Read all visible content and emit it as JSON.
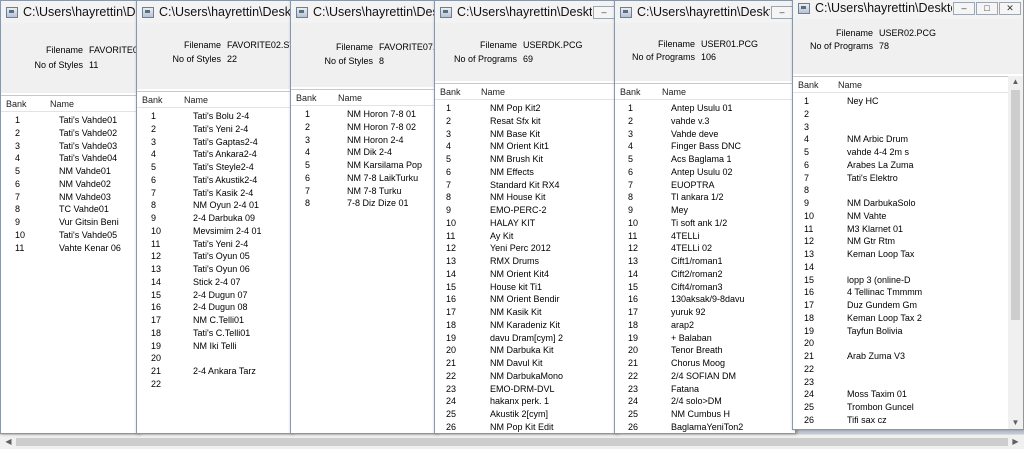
{
  "labels": {
    "filename": "Filename",
    "no_of_styles": "No of Styles",
    "no_of_programs": "No of Programs",
    "col_bank": "Bank",
    "col_name": "Name"
  },
  "windows": [
    {
      "title": "C:\\Users\\hayrettin\\Deskt",
      "filename": "FAVORITE0",
      "count_label_key": "no_of_styles",
      "count": "11",
      "rows": [
        [
          "1",
          "Tati's Vahde01"
        ],
        [
          "2",
          "Tati's Vahde02"
        ],
        [
          "3",
          "Tati's Vahde03"
        ],
        [
          "4",
          "Tati's Vahde04"
        ],
        [
          "5",
          "NM Vahde01"
        ],
        [
          "6",
          "NM Vahde02"
        ],
        [
          "7",
          "NM Vahde03"
        ],
        [
          "8",
          "TC Vahde01"
        ],
        [
          "9",
          "Vur Gitsin Beni"
        ],
        [
          "10",
          "Tati's Vahde05"
        ],
        [
          "11",
          "Vahte Kenar 06"
        ]
      ]
    },
    {
      "title": "C:\\Users\\hayrettin\\Deskt",
      "filename": "FAVORITE02.STY",
      "count_label_key": "no_of_styles",
      "count": "22",
      "rows": [
        [
          "1",
          "Tati's Bolu 2-4"
        ],
        [
          "2",
          "Tati's Yeni 2-4"
        ],
        [
          "3",
          "Tati's Gaptas2-4"
        ],
        [
          "4",
          "Tati's Ankara2-4"
        ],
        [
          "5",
          "Tati's Steyle2-4"
        ],
        [
          "6",
          "Tati's Akustik2-4"
        ],
        [
          "7",
          "Tati's Kasik 2-4"
        ],
        [
          "8",
          "NM Oyun 2-4 01"
        ],
        [
          "9",
          "2-4 Darbuka 09"
        ],
        [
          "10",
          "Mevsimim 2-4 01"
        ],
        [
          "11",
          "Tati's Yeni 2-4"
        ],
        [
          "12",
          "Tati's Oyun 05"
        ],
        [
          "13",
          "Tati's Oyun 06"
        ],
        [
          "14",
          "Stick 2-4 07"
        ],
        [
          "15",
          "2-4 Dugun 07"
        ],
        [
          "16",
          "2-4 Dugun 08"
        ],
        [
          "17",
          "NM C.Telli01"
        ],
        [
          "18",
          "Tati's C.Telli01"
        ],
        [
          "19",
          "NM Iki Telli"
        ],
        [
          "20",
          ""
        ],
        [
          "21",
          "2-4 Ankara Tarz"
        ],
        [
          "22",
          ""
        ]
      ]
    },
    {
      "title": "C:\\Users\\hayrettin\\Deskt",
      "filename": "FAVORITE07.",
      "count_label_key": "no_of_styles",
      "count": "8",
      "rows": [
        [
          "1",
          "NM Horon 7-8 01"
        ],
        [
          "2",
          "NM Horon 7-8 02"
        ],
        [
          "3",
          "NM Horon 2-4"
        ],
        [
          "4",
          "NM Dik 2-4"
        ],
        [
          "5",
          "NM Karsilama Pop"
        ],
        [
          "6",
          "NM 7-8 LaikTurku"
        ],
        [
          "7",
          "NM 7-8 Turku"
        ],
        [
          "8",
          "7-8 Diz Dize 01"
        ]
      ]
    },
    {
      "title": "C:\\Users\\hayrettin\\Desktc",
      "filename": "USERDK.PCG",
      "count_label_key": "no_of_programs",
      "count": "69",
      "rows": [
        [
          "1",
          "NM Pop Kit2"
        ],
        [
          "2",
          "Resat Sfx kit"
        ],
        [
          "3",
          "NM Base Kit"
        ],
        [
          "4",
          "NM Orient Kit1"
        ],
        [
          "5",
          "NM Brush Kit"
        ],
        [
          "6",
          "NM Effects"
        ],
        [
          "7",
          "Standard Kit RX4"
        ],
        [
          "8",
          "NM House Kit"
        ],
        [
          "9",
          "EMO-PERC-2"
        ],
        [
          "10",
          "HALAY KIT"
        ],
        [
          "11",
          "Ay Kit"
        ],
        [
          "12",
          "Yeni Perc 2012"
        ],
        [
          "13",
          "RMX Drums"
        ],
        [
          "14",
          "NM Orient Kit4"
        ],
        [
          "15",
          "House kit Ti1"
        ],
        [
          "16",
          "NM Orient Bendir"
        ],
        [
          "17",
          "NM Kasik Kit"
        ],
        [
          "18",
          "NM Karadeniz Kit"
        ],
        [
          "19",
          "davu Dram[cym] 2"
        ],
        [
          "20",
          "NM Darbuka Kit"
        ],
        [
          "21",
          "NM Davul Kit"
        ],
        [
          "22",
          "NM DarbukaMono"
        ],
        [
          "23",
          "EMO-DRM-DVL"
        ],
        [
          "24",
          "hakanx perk. 1"
        ],
        [
          "25",
          "Akustik 2[cym]"
        ],
        [
          "26",
          "NM Pop Kit Edit"
        ]
      ]
    },
    {
      "title": "C:\\Users\\hayrettin\\Deskt",
      "filename": "USER01.PCG",
      "count_label_key": "no_of_programs",
      "count": "106",
      "rows": [
        [
          "1",
          "Antep Usulu 01"
        ],
        [
          "2",
          "vahde v.3"
        ],
        [
          "3",
          "Vahde deve"
        ],
        [
          "4",
          "Finger Bass DNC"
        ],
        [
          "5",
          "Acs Baglama 1"
        ],
        [
          "6",
          "Antep Usulu 02"
        ],
        [
          "7",
          "EUOPTRA"
        ],
        [
          "8",
          "Tl ankara 1/2"
        ],
        [
          "9",
          "Mey"
        ],
        [
          "10",
          "Ti soft ank 1/2"
        ],
        [
          "11",
          "4TELLi"
        ],
        [
          "12",
          "4TELLi 02"
        ],
        [
          "13",
          "Cift1/roman1"
        ],
        [
          "14",
          "Cift2/roman2"
        ],
        [
          "15",
          "Cift4/roman3"
        ],
        [
          "16",
          "130aksak/9-8davu"
        ],
        [
          "17",
          "yuruk 92"
        ],
        [
          "18",
          "arap2"
        ],
        [
          "19",
          "+ Balaban"
        ],
        [
          "20",
          "Tenor Breath"
        ],
        [
          "21",
          "Chorus Moog"
        ],
        [
          "22",
          "2/4 SOFIAN DM"
        ],
        [
          "23",
          "Fatana"
        ],
        [
          "24",
          "2/4 solo>DM"
        ],
        [
          "25",
          "NM Cumbus H"
        ],
        [
          "26",
          "BaglamaYeniTon2"
        ]
      ]
    },
    {
      "title": "C:\\Users\\hayrettin\\Deskto",
      "filename": "USER02.PCG",
      "count_label_key": "no_of_programs",
      "count": "78",
      "rows": [
        [
          "1",
          "Ney HC"
        ],
        [
          "2",
          ""
        ],
        [
          "3",
          ""
        ],
        [
          "4",
          "NM Arbic Drum"
        ],
        [
          "5",
          "vahde 4-4 2m s"
        ],
        [
          "6",
          "Arabes La Zuma"
        ],
        [
          "7",
          "Tati's Elektro"
        ],
        [
          "8",
          ""
        ],
        [
          "9",
          "NM DarbukaSolo"
        ],
        [
          "10",
          "NM Vahte"
        ],
        [
          "11",
          "M3 Klarnet 01"
        ],
        [
          "12",
          "NM Gtr Rtm"
        ],
        [
          "13",
          "Keman Loop Tax"
        ],
        [
          "14",
          ""
        ],
        [
          "15",
          "lopp 3 (online-D"
        ],
        [
          "16",
          "4 Tellinac Tmmmm"
        ],
        [
          "17",
          "Duz Gundem Gm"
        ],
        [
          "18",
          "Keman Loop Tax 2"
        ],
        [
          "19",
          "Tayfun Bolivia"
        ],
        [
          "20",
          ""
        ],
        [
          "21",
          "Arab Zuma V3"
        ],
        [
          "22",
          ""
        ],
        [
          "23",
          ""
        ],
        [
          "24",
          "Moss Taxim 01"
        ],
        [
          "25",
          "Trombon Guncel"
        ],
        [
          "26",
          "Tifi sax cz"
        ]
      ]
    }
  ]
}
